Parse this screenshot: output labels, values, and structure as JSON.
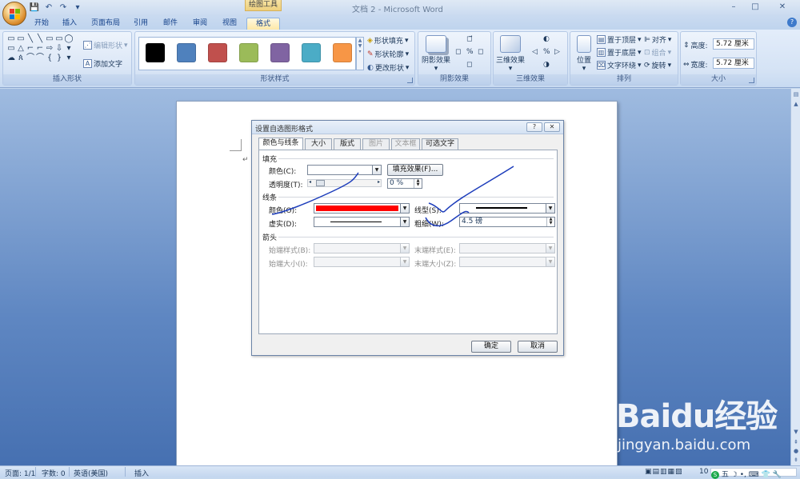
{
  "app": {
    "doc_title": "文档 2 - Microsoft Word",
    "context_tab_title": "绘图工具",
    "help": "?"
  },
  "qat": {
    "save": "💾",
    "undo": "↶",
    "redo": "↷",
    "more": "▾"
  },
  "window_controls": {
    "minimize": "–",
    "maximize": "□",
    "close": "✕"
  },
  "tabs": [
    "开始",
    "插入",
    "页面布局",
    "引用",
    "邮件",
    "审阅",
    "视图",
    "格式"
  ],
  "ribbon": {
    "insert_shapes": {
      "label": "插入形状",
      "shape_glyphs": [
        "▭",
        "▭",
        "╲",
        "╲",
        "▭",
        "▭",
        "◯",
        "▭",
        "△",
        "⌐",
        "⌐",
        "⇨",
        "⇩",
        "▾",
        "☁",
        "ጰ",
        "⌒",
        "⌒",
        "{",
        "}",
        "▾"
      ],
      "edit_shape": "编辑形状",
      "add_text": "添加文字"
    },
    "shape_styles": {
      "label": "形状样式",
      "swatches": [
        "#000000",
        "#4f81bd",
        "#c0504d",
        "#9bbb59",
        "#8064a2",
        "#4bacc6",
        "#f79646"
      ],
      "fill": "形状填充",
      "outline": "形状轮廓",
      "change": "更改形状"
    },
    "shadow": {
      "label": "阴影效果",
      "button": "阴影效果"
    },
    "threed": {
      "label": "三维效果",
      "button": "三维效果"
    },
    "arrange": {
      "label": "排列",
      "position": "位置",
      "bring_front": "置于顶层",
      "send_back": "置于底层",
      "text_wrap": "文字环绕",
      "align": "对齐",
      "group": "组合",
      "rotate": "旋转"
    },
    "size": {
      "label": "大小",
      "height_label": "高度:",
      "height_value": "5.72 厘米",
      "width_label": "宽度:",
      "width_value": "5.72 厘米"
    }
  },
  "dialog": {
    "title": "设置自选图形格式",
    "help_btn": "?",
    "close_btn": "✕",
    "tabs": [
      "颜色与线条",
      "大小",
      "版式",
      "图片",
      "文本框",
      "可选文字"
    ],
    "fill": {
      "section": "填充",
      "color_label": "颜色(C):",
      "effects_btn": "填充效果(F)...",
      "transparency_label": "透明度(T):",
      "transparency_value": "0 %"
    },
    "line": {
      "section": "线条",
      "color_label": "颜色(O):",
      "color_value": "#ff0000",
      "style_label": "线型(S):",
      "dash_label": "虚实(D):",
      "weight_label": "粗细(W):",
      "weight_value": "4.5 磅"
    },
    "arrows": {
      "section": "箭头",
      "begin_style": "始端样式(B):",
      "end_style": "末端样式(E):",
      "begin_size": "始端大小(I):",
      "end_size": "末端大小(Z):"
    },
    "ok": "确定",
    "cancel": "取消"
  },
  "statusbar": {
    "page": "页面: 1/1",
    "words": "字数: 0",
    "language": "英语(美国)",
    "mode": "插入",
    "zoom": "10"
  },
  "watermark": {
    "brand": "Baidu经验",
    "url": "jingyan.baidu.com"
  }
}
